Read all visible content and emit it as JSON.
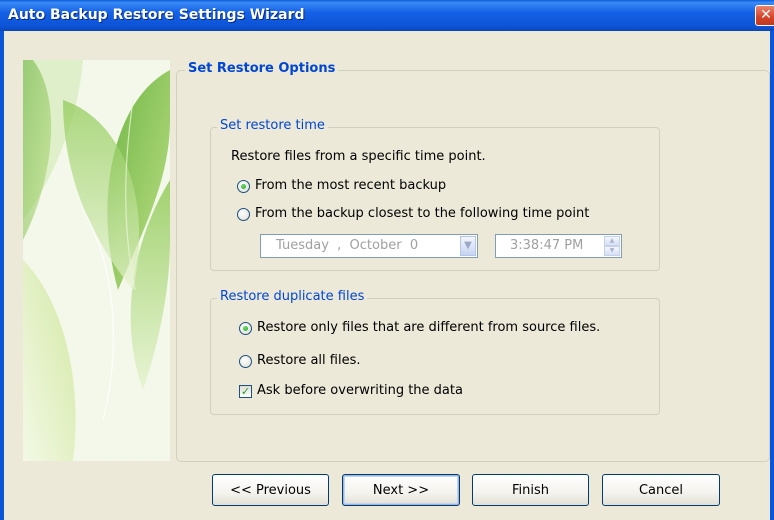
{
  "window": {
    "title": "Auto Backup Restore Settings Wizard",
    "close_glyph": "✕"
  },
  "page": {
    "section_title": "Set Restore Options"
  },
  "restore_time": {
    "legend": "Set restore time",
    "description": "Restore files from a specific time point.",
    "options": [
      {
        "label": "From the most recent backup",
        "selected": true
      },
      {
        "label": "From the backup closest to the following time point",
        "selected": false
      }
    ],
    "date_value": "Tuesday  ,  October  0",
    "time_value": "3:38:47 PM"
  },
  "duplicates": {
    "legend": "Restore duplicate files",
    "options": [
      {
        "label": "Restore only files that are different from source files.",
        "selected": true
      },
      {
        "label": "Restore all files.",
        "selected": false
      }
    ],
    "ask_before_overwrite": {
      "label": "Ask before overwriting the data",
      "checked": true
    }
  },
  "buttons": {
    "previous": "<< Previous",
    "next": "Next >>",
    "finish": "Finish",
    "cancel": "Cancel"
  },
  "colors": {
    "title_bar": "#0d53d6",
    "group_title": "#0046d5",
    "dialog_background": "#ece9d8"
  },
  "icons": {
    "close": "close-icon",
    "date_dropdown": "chevron-down-icon",
    "time_spinner": "spin-arrows-icon",
    "checkbox_mark": "check-icon"
  }
}
